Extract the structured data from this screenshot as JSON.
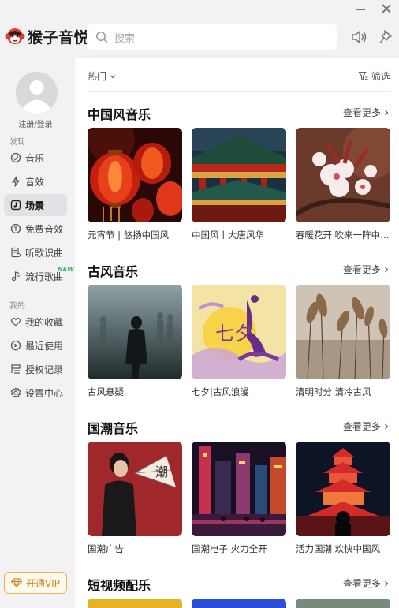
{
  "app": {
    "name": "猴子音悦"
  },
  "search": {
    "placeholder": "搜索"
  },
  "sidebar": {
    "login_label": "注册/登录",
    "discover_label": "发现",
    "discover_items": [
      {
        "label": "音乐",
        "icon": "disc-icon"
      },
      {
        "label": "音效",
        "icon": "bolt-icon"
      },
      {
        "label": "场景",
        "icon": "music-note-icon",
        "active": true
      },
      {
        "label": "免费音效",
        "icon": "free-icon"
      },
      {
        "label": "听歌识曲",
        "icon": "recognize-icon"
      },
      {
        "label": "流行歌曲",
        "icon": "note-icon",
        "badge": "NEW"
      }
    ],
    "mine_label": "我的",
    "mine_items": [
      {
        "label": "我的收藏",
        "icon": "heart-icon"
      },
      {
        "label": "最近使用",
        "icon": "history-icon"
      },
      {
        "label": "授权记录",
        "icon": "license-icon"
      },
      {
        "label": "设置中心",
        "icon": "gear-icon"
      }
    ],
    "vip_label": "开通VIP"
  },
  "filter_bar": {
    "sort_label": "热门",
    "filter_label": "筛选"
  },
  "sections": [
    {
      "title": "中国风音乐",
      "more_label": "查看更多",
      "cards": [
        {
          "caption": "元宵节 | 悠扬中国风"
        },
        {
          "caption": "中国风丨大唐风华"
        },
        {
          "caption": "春暖花开 吹来一阵中国风"
        }
      ]
    },
    {
      "title": "古风音乐",
      "more_label": "查看更多",
      "cards": [
        {
          "caption": "古风悬疑"
        },
        {
          "caption": "七夕|古风浪漫",
          "art_text": "七夕"
        },
        {
          "caption": "清明时分 清冷古风"
        }
      ]
    },
    {
      "title": "国潮音乐",
      "more_label": "查看更多",
      "cards": [
        {
          "caption": "国潮广告",
          "art_text": "潮"
        },
        {
          "caption": "国潮电子 火力全开"
        },
        {
          "caption": "活力国潮 欢快中国风"
        }
      ]
    },
    {
      "title": "短视频配乐",
      "more_label": "查看更多",
      "cards": []
    }
  ],
  "colors": {
    "accent_vip": "#cf8a1d",
    "new_badge": "#2bbf5e",
    "logo_red": "#e23b2e"
  }
}
